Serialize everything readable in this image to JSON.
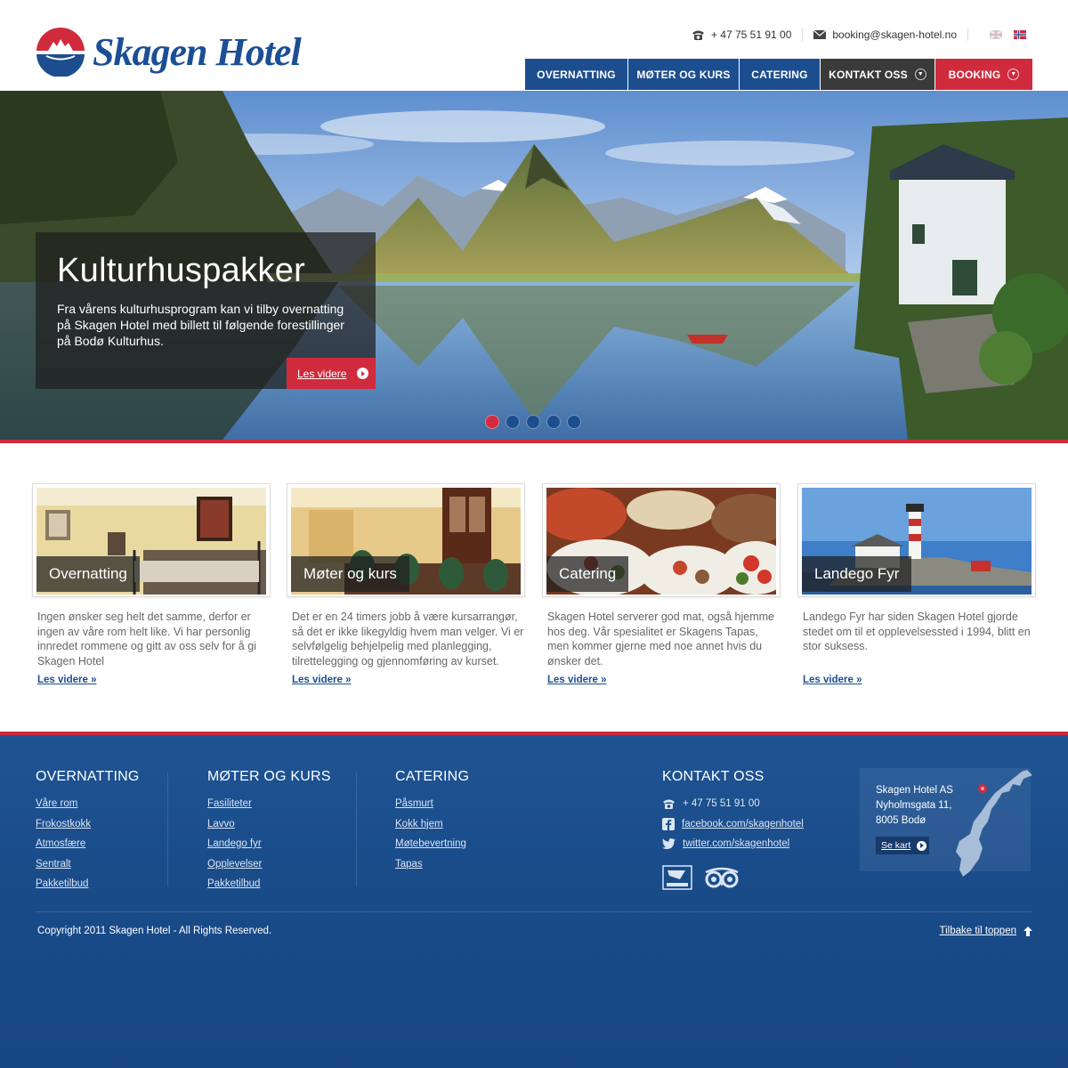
{
  "brand": {
    "name": "Skagen Hotel"
  },
  "contact_bar": {
    "phone": "+ 47 75 51 91 00",
    "email": "booking@skagen-hotel.no"
  },
  "nav": [
    {
      "label": "Overnatting",
      "style": "blue"
    },
    {
      "label": "Møter og kurs",
      "style": "blue"
    },
    {
      "label": "Catering",
      "style": "blue"
    },
    {
      "label": "Kontakt oss",
      "style": "dark"
    },
    {
      "label": "Booking",
      "style": "red"
    }
  ],
  "hero": {
    "title": "Kulturhuspakker",
    "text": "Fra vårens kulturhusprogram kan vi tilby overnatting på Skagen Hotel med billett til følgende forestillinger på Bodø Kulturhus.",
    "button": "Les videre",
    "slides_total": 5,
    "active_slide": 1
  },
  "features": [
    {
      "title": "Overnatting",
      "text": "Ingen ønsker seg helt det samme, derfor er ingen av våre rom helt like.  Vi har personlig innredet rommene og gitt av oss selv for å gi Skagen Hotel",
      "more": "Les videre »"
    },
    {
      "title": "Møter og kurs",
      "text": "Det er en 24 timers jobb å være kursarrangør, så det er ikke likegyldig hvem man velger.  Vi er selvfølgelig behjelpelig med planlegging, tilrettelegging og gjennomføring av kurset.",
      "more": "Les videre »"
    },
    {
      "title": "Catering",
      "text": "Skagen Hotel serverer god mat, også hjemme hos deg. Vår spesialitet er Skagens Tapas, men kommer gjerne med noe annet hvis du ønsker det.",
      "more": "Les videre »"
    },
    {
      "title": "Landego Fyr",
      "text": "Landego Fyr har siden Skagen Hotel gjorde stedet om til et opplevelsessted i 1994, blitt en stor suksess.",
      "more": "Les videre »"
    }
  ],
  "footer": {
    "overnatting": {
      "title": "Overnatting",
      "links": [
        "Våre rom",
        "Frokostkokk",
        "Atmosfære",
        "Sentralt",
        "Pakketilbud"
      ]
    },
    "moter": {
      "title": "Møter og kurs",
      "links": [
        "Fasiliteter",
        "Lavvo",
        "Landego fyr",
        "Opplevelser",
        "Pakketilbud"
      ]
    },
    "catering": {
      "title": "Catering",
      "links": [
        "Påsmurt",
        "Kokk hjem",
        "Møtebevertning",
        "Tapas"
      ]
    },
    "kontakt": {
      "title": "Kontakt oss",
      "phone": "+ 47 75 51 91 00",
      "facebook": "facebook.com/skagenhotel",
      "twitter": "twitter.com/skagenhotel"
    },
    "address": {
      "line1": "Skagen Hotel AS",
      "line2": "Nyholmsgata 11,",
      "line3": "8005 Bodø",
      "map_button": "Se kart"
    },
    "copyright": "Copyright 2011 Skagen Hotel - All Rights Reserved.",
    "to_top": "Tilbake til toppen"
  },
  "colors": {
    "blue": "#1c4e8f",
    "red": "#d02b3d",
    "dark": "#3a3a3a"
  }
}
